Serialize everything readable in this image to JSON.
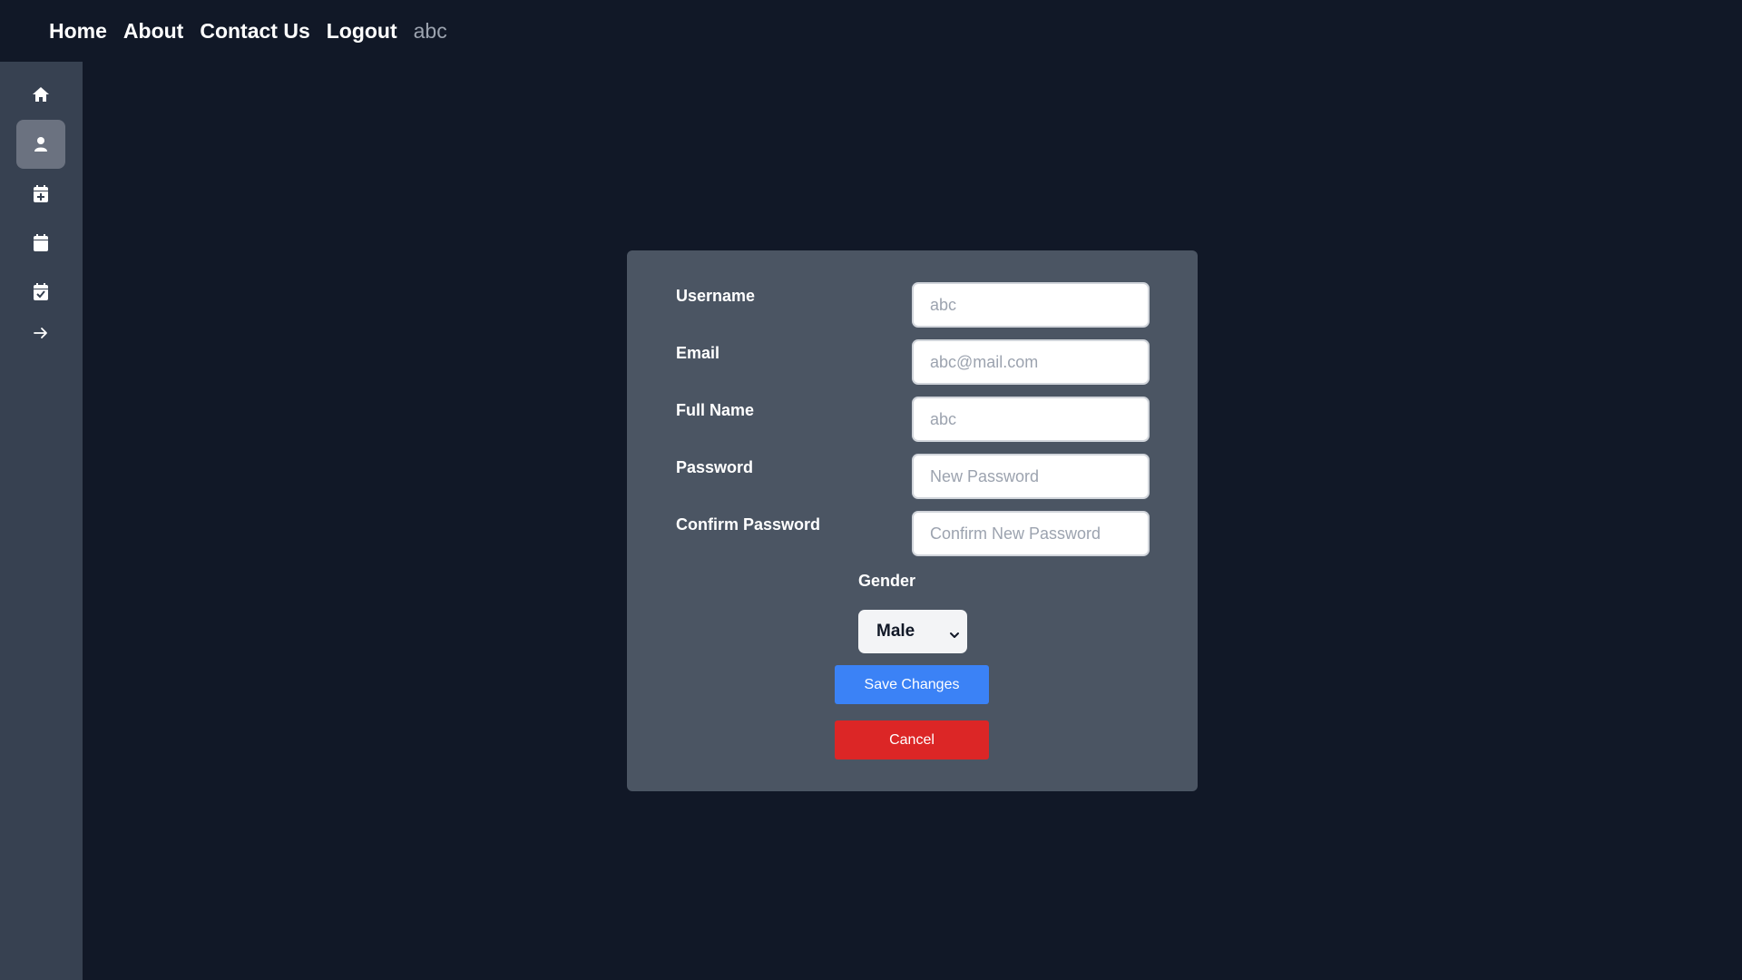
{
  "nav": {
    "links": [
      "Home",
      "About",
      "Contact Us",
      "Logout"
    ],
    "username": "abc"
  },
  "sidebar": {
    "items": [
      {
        "icon": "home-icon"
      },
      {
        "icon": "user-icon",
        "active": true
      },
      {
        "icon": "calendar-plus-icon"
      },
      {
        "icon": "calendar-icon"
      },
      {
        "icon": "calendar-check-icon"
      },
      {
        "icon": "arrow-right-icon"
      }
    ]
  },
  "form": {
    "fields": [
      {
        "label": "Username",
        "placeholder": "abc"
      },
      {
        "label": "Email",
        "placeholder": "abc@mail.com"
      },
      {
        "label": "Full Name",
        "placeholder": "abc"
      },
      {
        "label": "Password",
        "placeholder": "New Password"
      },
      {
        "label": "Confirm Password",
        "placeholder": "Confirm New Password"
      }
    ],
    "gender_label": "Gender",
    "gender_value": "Male",
    "save_label": "Save Changes",
    "cancel_label": "Cancel"
  },
  "colors": {
    "background": "#111827",
    "sidebar": "#374151",
    "card": "#4b5563",
    "save": "#3b82f6",
    "cancel": "#dc2626"
  }
}
